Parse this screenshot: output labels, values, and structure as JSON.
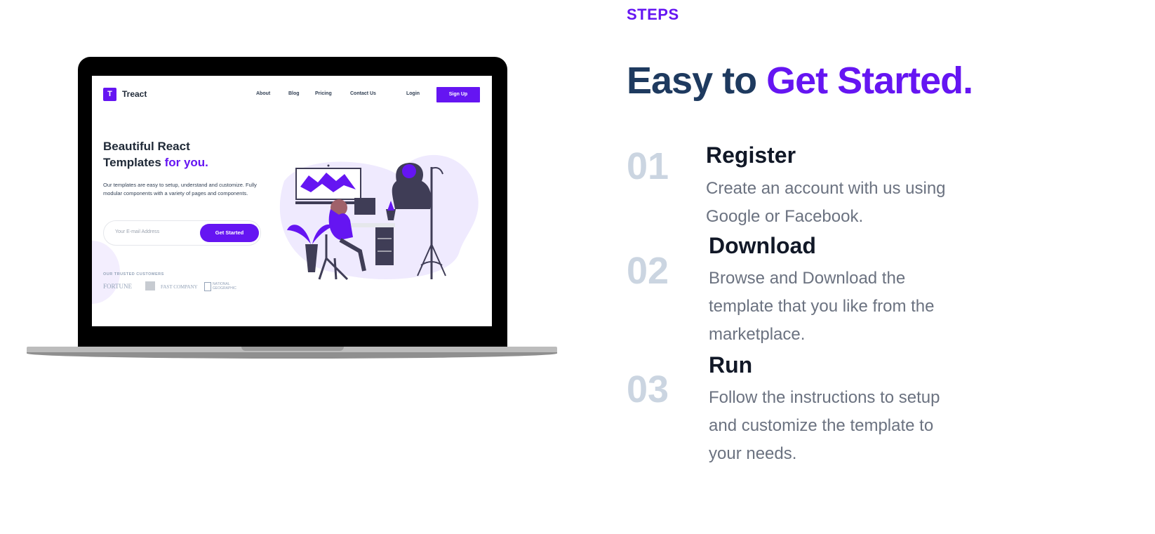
{
  "mockup": {
    "brand": "Treact",
    "logo_letter": "T",
    "nav": [
      "About",
      "Blog",
      "Pricing",
      "Contact Us"
    ],
    "login": "Login",
    "signup": "Sign Up",
    "hero_line1": "Beautiful React",
    "hero_line2": "Templates ",
    "hero_accent": "for you.",
    "description": "Our templates are easy to setup, understand and customize. Fully modular components with a variety of pages and components.",
    "email_placeholder": "Your E-mail Address",
    "cta": "Get Started",
    "trusted_label": "OUR TRUSTED CUSTOMERS",
    "customer_logos": [
      "FORTUNE",
      "FAST COMPANY",
      "NATIONAL GEOGRAPHIC"
    ]
  },
  "section": {
    "label": "STEPS",
    "title_main": "Easy to ",
    "title_accent": "Get Started."
  },
  "steps": [
    {
      "number": "01",
      "title": "Register",
      "desc_lines": [
        "Create an account with us using",
        "Google or Facebook."
      ]
    },
    {
      "number": "02",
      "title": "Download",
      "desc_lines": [
        "Browse and Download the",
        "template that you like from the",
        "marketplace."
      ]
    },
    {
      "number": "03",
      "title": "Run",
      "desc_lines": [
        "Follow the instructions to setup",
        "and customize the template to",
        "your needs."
      ]
    }
  ],
  "colors": {
    "accent": "#6515f2",
    "heading": "#1e3a5f",
    "step_number": "#cbd5e1",
    "body_text": "#6b7280"
  }
}
